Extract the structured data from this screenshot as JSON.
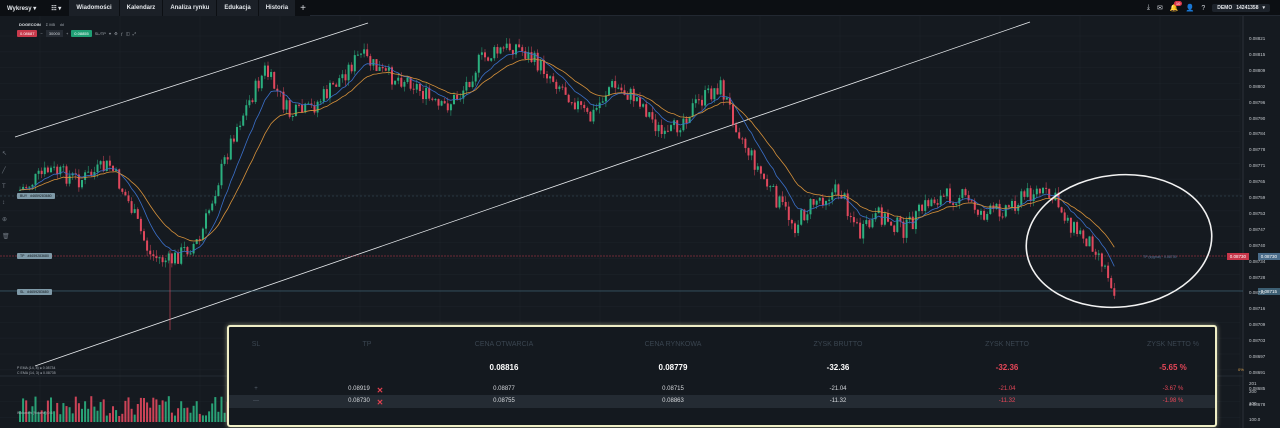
{
  "menu": {
    "items": [
      {
        "label": "Wykresy ▾"
      },
      {
        "label": "☷ ▾"
      },
      {
        "label": "Wiadomości"
      },
      {
        "label": "Kalendarz"
      },
      {
        "label": "Analiza rynku"
      },
      {
        "label": "Edukacja"
      },
      {
        "label": "Historia"
      }
    ],
    "add_label": "+"
  },
  "topright": {
    "badge": "10",
    "account_mode": "DEMO",
    "account_id": "14241358",
    "account_caret": "▾"
  },
  "symbol": {
    "name": "DOGECOIN",
    "timeframe": "Ʃ M5",
    "chart_type": "ılıl"
  },
  "order": {
    "sell_price": "0.08687",
    "quantity": "30000",
    "buy_price": "0.08855",
    "sltp_label": "SL/TP"
  },
  "lines": {
    "buy_tag": {
      "side": "BUY",
      "value": "#4659283680"
    },
    "tp_tag": {
      "side": "TP",
      "value": "#4659283680"
    },
    "sl_tag": {
      "side": "SL",
      "value": "#4659283680"
    },
    "tp_note": "TP (sygnał) · 0.08739",
    "tp_price": "0.08730",
    "current_price": "0.08730",
    "sl_price": "0.08715"
  },
  "legends": {
    "ema1": "P EMA (14, 8) ● 0.08734",
    "ema2": "C EMA (14, 3) ● 0.08735",
    "volume": "Wolumen (Volume) 0.6",
    "change_pct": "0%"
  },
  "price_axis": [
    "0.08821",
    "0.08815",
    "0.08809",
    "0.08802",
    "0.08796",
    "0.08790",
    "0.08784",
    "0.08778",
    "0.08771",
    "0.08765",
    "0.08759",
    "0.08753",
    "0.08747",
    "0.08740",
    "0.08734",
    "0.08728",
    "0.08722",
    "0.08716",
    "0.08709",
    "0.08703",
    "0.08697",
    "0.08691",
    "0.08685",
    "0.08678"
  ],
  "volume_axis": [
    "201",
    "200",
    "100",
    "100.0"
  ],
  "positions_panel": {
    "headers": [
      "SL",
      "TP",
      "CENA OTWARCIA",
      "CENA RYNKOWA",
      "ZYSK BRUTTO",
      "ZYSK NETTO",
      "ZYSK NETTO %"
    ],
    "total": {
      "open": "0.08816",
      "market": "0.08779",
      "gross": "-32.36",
      "net": "-32.36",
      "net_pct": "-5.65 %"
    },
    "rows": [
      {
        "sl": "+",
        "tp": "0.08919",
        "open": "0.08877",
        "market": "0.08715",
        "gross": "-21.04",
        "net": "-21.04",
        "net_pct": "-3.67 %"
      },
      {
        "sl": "—",
        "tp": "0.08730",
        "open": "0.08755",
        "market": "0.08863",
        "gross": "-11.32",
        "net": "-11.32",
        "net_pct": "-1.98 %"
      }
    ]
  },
  "colors": {
    "background": "#151a20",
    "bull": "#2bb07f",
    "bear": "#e0485d",
    "ema_blue": "#3a6fc8",
    "ema_orange": "#d6913a",
    "highlight": "#efeec6"
  }
}
